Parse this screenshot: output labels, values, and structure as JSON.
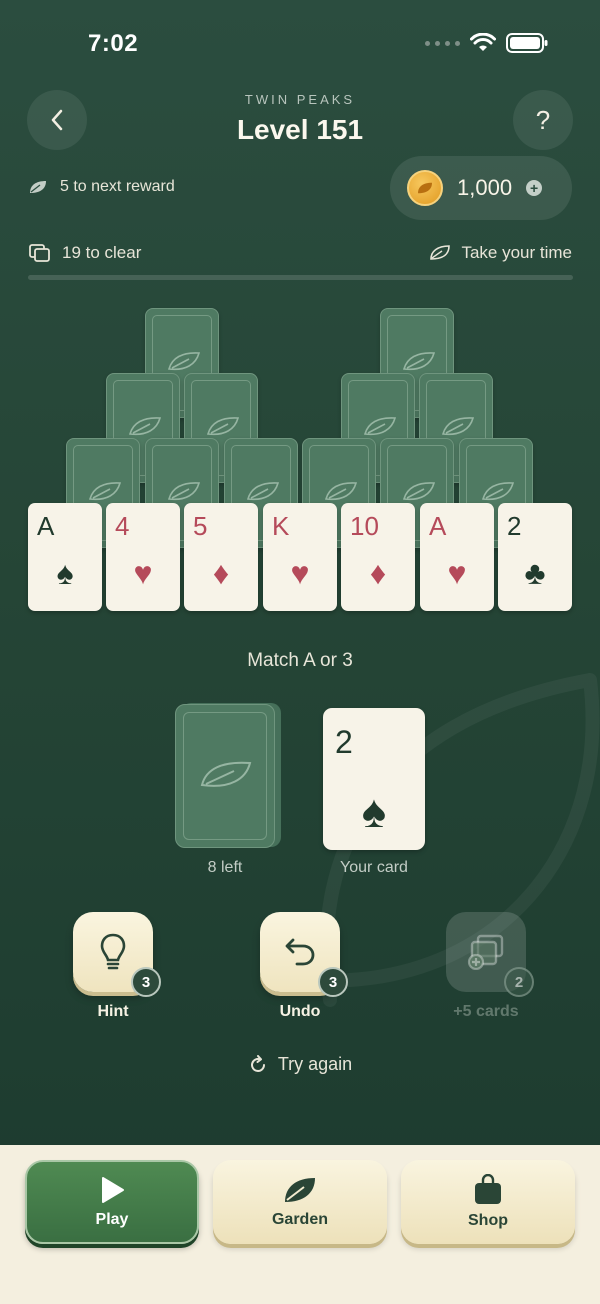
{
  "status": {
    "time": "7:02"
  },
  "header": {
    "subtitle": "TWIN PEAKS",
    "title": "Level 151",
    "help_label": "?"
  },
  "reward": {
    "text": "5 to next reward"
  },
  "coins": {
    "amount": "1,000"
  },
  "info": {
    "to_clear": "19 to clear",
    "pace": "Take your time",
    "progress": 0
  },
  "pyramids": {
    "face_up": [
      {
        "rank": "A",
        "suit": "♠",
        "color": "black"
      },
      {
        "rank": "4",
        "suit": "♥",
        "color": "red"
      },
      {
        "rank": "5",
        "suit": "♦",
        "color": "red"
      },
      {
        "rank": "K",
        "suit": "♥",
        "color": "red"
      },
      {
        "rank": "10",
        "suit": "♦",
        "color": "red"
      },
      {
        "rank": "A",
        "suit": "♥",
        "color": "red"
      },
      {
        "rank": "2",
        "suit": "♣",
        "color": "black"
      }
    ]
  },
  "match_text": "Match A or 3",
  "stock": {
    "label": "8 left"
  },
  "waste": {
    "rank": "2",
    "suit": "♠",
    "label": "Your card"
  },
  "tools": [
    {
      "label": "Hint",
      "count": "3",
      "icon": "lightbulb-icon",
      "enabled": true
    },
    {
      "label": "Undo",
      "count": "3",
      "icon": "undo-icon",
      "enabled": true
    },
    {
      "label": "+5 cards",
      "count": "2",
      "icon": "add-cards-icon",
      "enabled": false
    }
  ],
  "try_again": "Try again",
  "nav": [
    {
      "label": "Play",
      "icon": "play-icon",
      "active": true
    },
    {
      "label": "Garden",
      "icon": "leaf-icon",
      "active": false
    },
    {
      "label": "Shop",
      "icon": "bag-icon",
      "active": false
    }
  ],
  "colors": {
    "background": "#254536",
    "card_back": "#4f7a62",
    "card_face": "#f7f3e8",
    "red_suit": "#b54a5a",
    "black_suit": "#213a2d",
    "accent": "#e19a21"
  }
}
